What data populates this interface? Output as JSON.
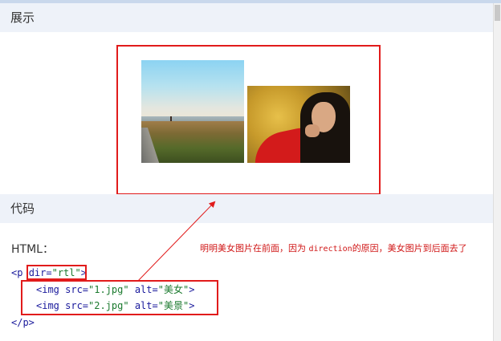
{
  "sections": {
    "demo_title": "展示",
    "code_title": "代码"
  },
  "images": {
    "img1_alt": "美女",
    "img2_alt": "美景"
  },
  "code": {
    "html_label": "HTML：",
    "line1": {
      "open": "<p ",
      "attr": "dir=",
      "value": "\"rtl\"",
      "close": ">"
    },
    "line2": {
      "open": "<img ",
      "attr_src": "src=",
      "src_value": "\"1.jpg\"",
      "attr_alt": " alt=",
      "alt_value": "\"美女\"",
      "close": ">"
    },
    "line3": {
      "open": "<img ",
      "attr_src": "src=",
      "src_value": "\"2.jpg\"",
      "attr_alt": " alt=",
      "alt_value": "\"美景\"",
      "close": ">"
    },
    "line4": "</p>"
  },
  "annotation": {
    "before": "明明美女图片在前面，因为 ",
    "keyword": "direction",
    "after": "的原因，美女图片到后面去了"
  },
  "colors": {
    "highlight": "#e11b1b",
    "header_bg": "#eef2f9"
  }
}
